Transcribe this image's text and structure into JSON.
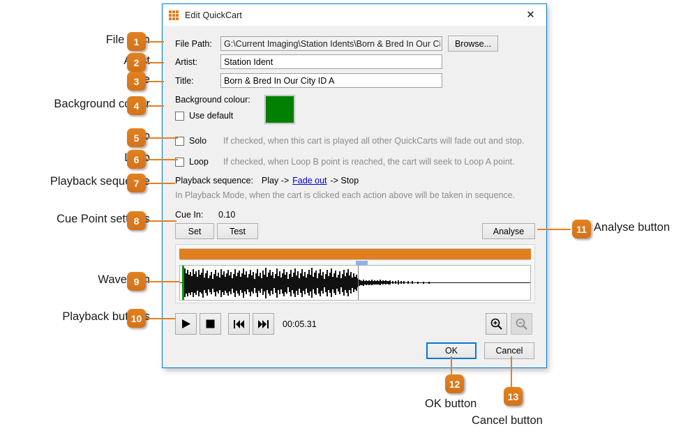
{
  "window": {
    "title": "Edit QuickCart",
    "icon": "grid-icon",
    "close_label": "✕",
    "accent_color": "#0078d7"
  },
  "form": {
    "file_path_label": "File Path:",
    "file_path_value": "G:\\Current Imaging\\Station Idents\\Born & Bred In Our City ID A.",
    "browse_label": "Browse...",
    "artist_label": "Artist:",
    "artist_value": "Station Ident",
    "title_label": "Title:",
    "title_value": "Born & Bred In Our City ID A",
    "background_colour_label": "Background colour:",
    "use_default_label": "Use default",
    "background_colour_value": "#008000",
    "solo_label": "Solo",
    "solo_hint": "If checked, when this cart is played all other QuickCarts will fade out and stop.",
    "loop_label": "Loop",
    "loop_hint": "If checked, when Loop B point is reached, the cart will seek to Loop A point.",
    "playback_sequence_label": "Playback sequence:",
    "sequence_play": "Play ->",
    "sequence_link": "Fade out",
    "sequence_stop": "-> Stop",
    "playback_mode_hint": "In Playback Mode, when the cart is clicked each action above will be taken in sequence."
  },
  "cue": {
    "cue_in_label": "Cue In:",
    "cue_in_value": "0.10",
    "set_label": "Set",
    "test_label": "Test",
    "analyse_label": "Analyse"
  },
  "transport": {
    "play_icon": "play-icon",
    "stop_icon": "stop-icon",
    "prev_icon": "skip-back-icon",
    "next_icon": "skip-forward-icon",
    "timecode": "00:05.31",
    "zoom_in_icon": "zoom-in-icon",
    "zoom_out_icon": "zoom-out-icon"
  },
  "footer": {
    "ok_label": "OK",
    "cancel_label": "Cancel"
  },
  "annotations": {
    "accent_color": "#e2811f",
    "items": [
      {
        "num": "1",
        "label": "File path"
      },
      {
        "num": "2",
        "label": "Artist"
      },
      {
        "num": "3",
        "label": "Title"
      },
      {
        "num": "4",
        "label": "Background colour"
      },
      {
        "num": "5",
        "label": "Solo"
      },
      {
        "num": "6",
        "label": "Loop"
      },
      {
        "num": "7",
        "label": "Playback sequence"
      },
      {
        "num": "8",
        "label": "Cue Point settings"
      },
      {
        "num": "9",
        "label": "Waveform"
      },
      {
        "num": "10",
        "label": "Playback buttons"
      },
      {
        "num": "11",
        "label": "Analyse button"
      },
      {
        "num": "12",
        "label": "OK button"
      },
      {
        "num": "13",
        "label": "Cancel button"
      }
    ]
  }
}
